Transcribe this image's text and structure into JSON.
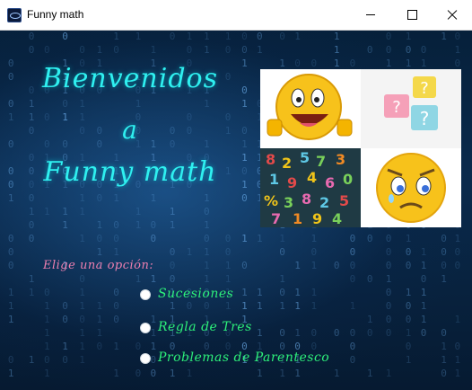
{
  "window": {
    "title": "Funny math",
    "controls": {
      "minimize": "minimize-icon",
      "maximize": "maximize-icon",
      "close": "close-icon"
    }
  },
  "welcome": {
    "line1": "Bienvenidos",
    "line2": "a",
    "line3": "Funny math"
  },
  "images": [
    {
      "name": "smiley-thumbs-up-image"
    },
    {
      "name": "question-bubbles-image"
    },
    {
      "name": "numbers-pattern-image"
    },
    {
      "name": "sad-smiley-image"
    }
  ],
  "prompt": "Elige una opción:",
  "options": [
    {
      "label": "Sucesiones",
      "selected": false
    },
    {
      "label": "Regla de Tres",
      "selected": false
    },
    {
      "label": "Problemas de Parentesco",
      "selected": false
    }
  ],
  "colors": {
    "welcome_text": "#2ff0f0",
    "prompt_text": "#ee7fb0",
    "option_text": "#2df07a",
    "background": "#0a2b4d"
  }
}
